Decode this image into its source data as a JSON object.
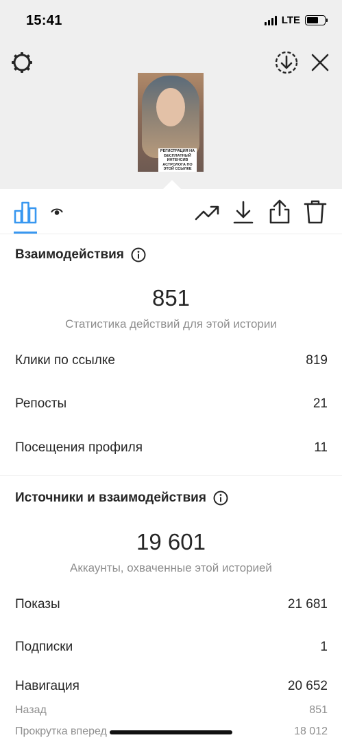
{
  "status_bar": {
    "time": "15:41",
    "network": "LTE"
  },
  "story": {
    "caption": "РЕГИСТРАЦИЯ НА БЕСПЛАТНЫЙ ИНТЕНСИВ АСТРОЛОГА ПО ЭТОЙ ССЫЛКЕ"
  },
  "icons": {
    "settings": "settings-icon",
    "download_circle": "download-circle-icon",
    "close": "close-icon",
    "stats": "bar-chart-icon",
    "views": "eye-icon",
    "promote": "trending-up-icon",
    "download": "download-icon",
    "share": "share-icon",
    "delete": "trash-icon",
    "info": "info-icon"
  },
  "colors": {
    "accent": "#3897f0",
    "muted": "#8e8e8e",
    "text": "#262626"
  },
  "interactions": {
    "title": "Взаимодействия",
    "total": "851",
    "subtitle": "Статистика действий для этой истории",
    "rows": [
      {
        "label": "Клики по ссылке",
        "value": "819"
      },
      {
        "label": "Репосты",
        "value": "21"
      },
      {
        "label": "Посещения профиля",
        "value": "11"
      }
    ]
  },
  "discovery": {
    "title": "Источники и взаимодействия",
    "total": "19 601",
    "subtitle": "Аккаунты, охваченные этой историей",
    "rows": [
      {
        "label": "Показы",
        "value": "21 681"
      },
      {
        "label": "Подписки",
        "value": "1"
      },
      {
        "label": "Навигация",
        "value": "20 652"
      }
    ],
    "sub_rows": [
      {
        "label": "Назад",
        "value": "851"
      },
      {
        "label": "Прокрутка вперед",
        "value": "18 012"
      }
    ]
  }
}
